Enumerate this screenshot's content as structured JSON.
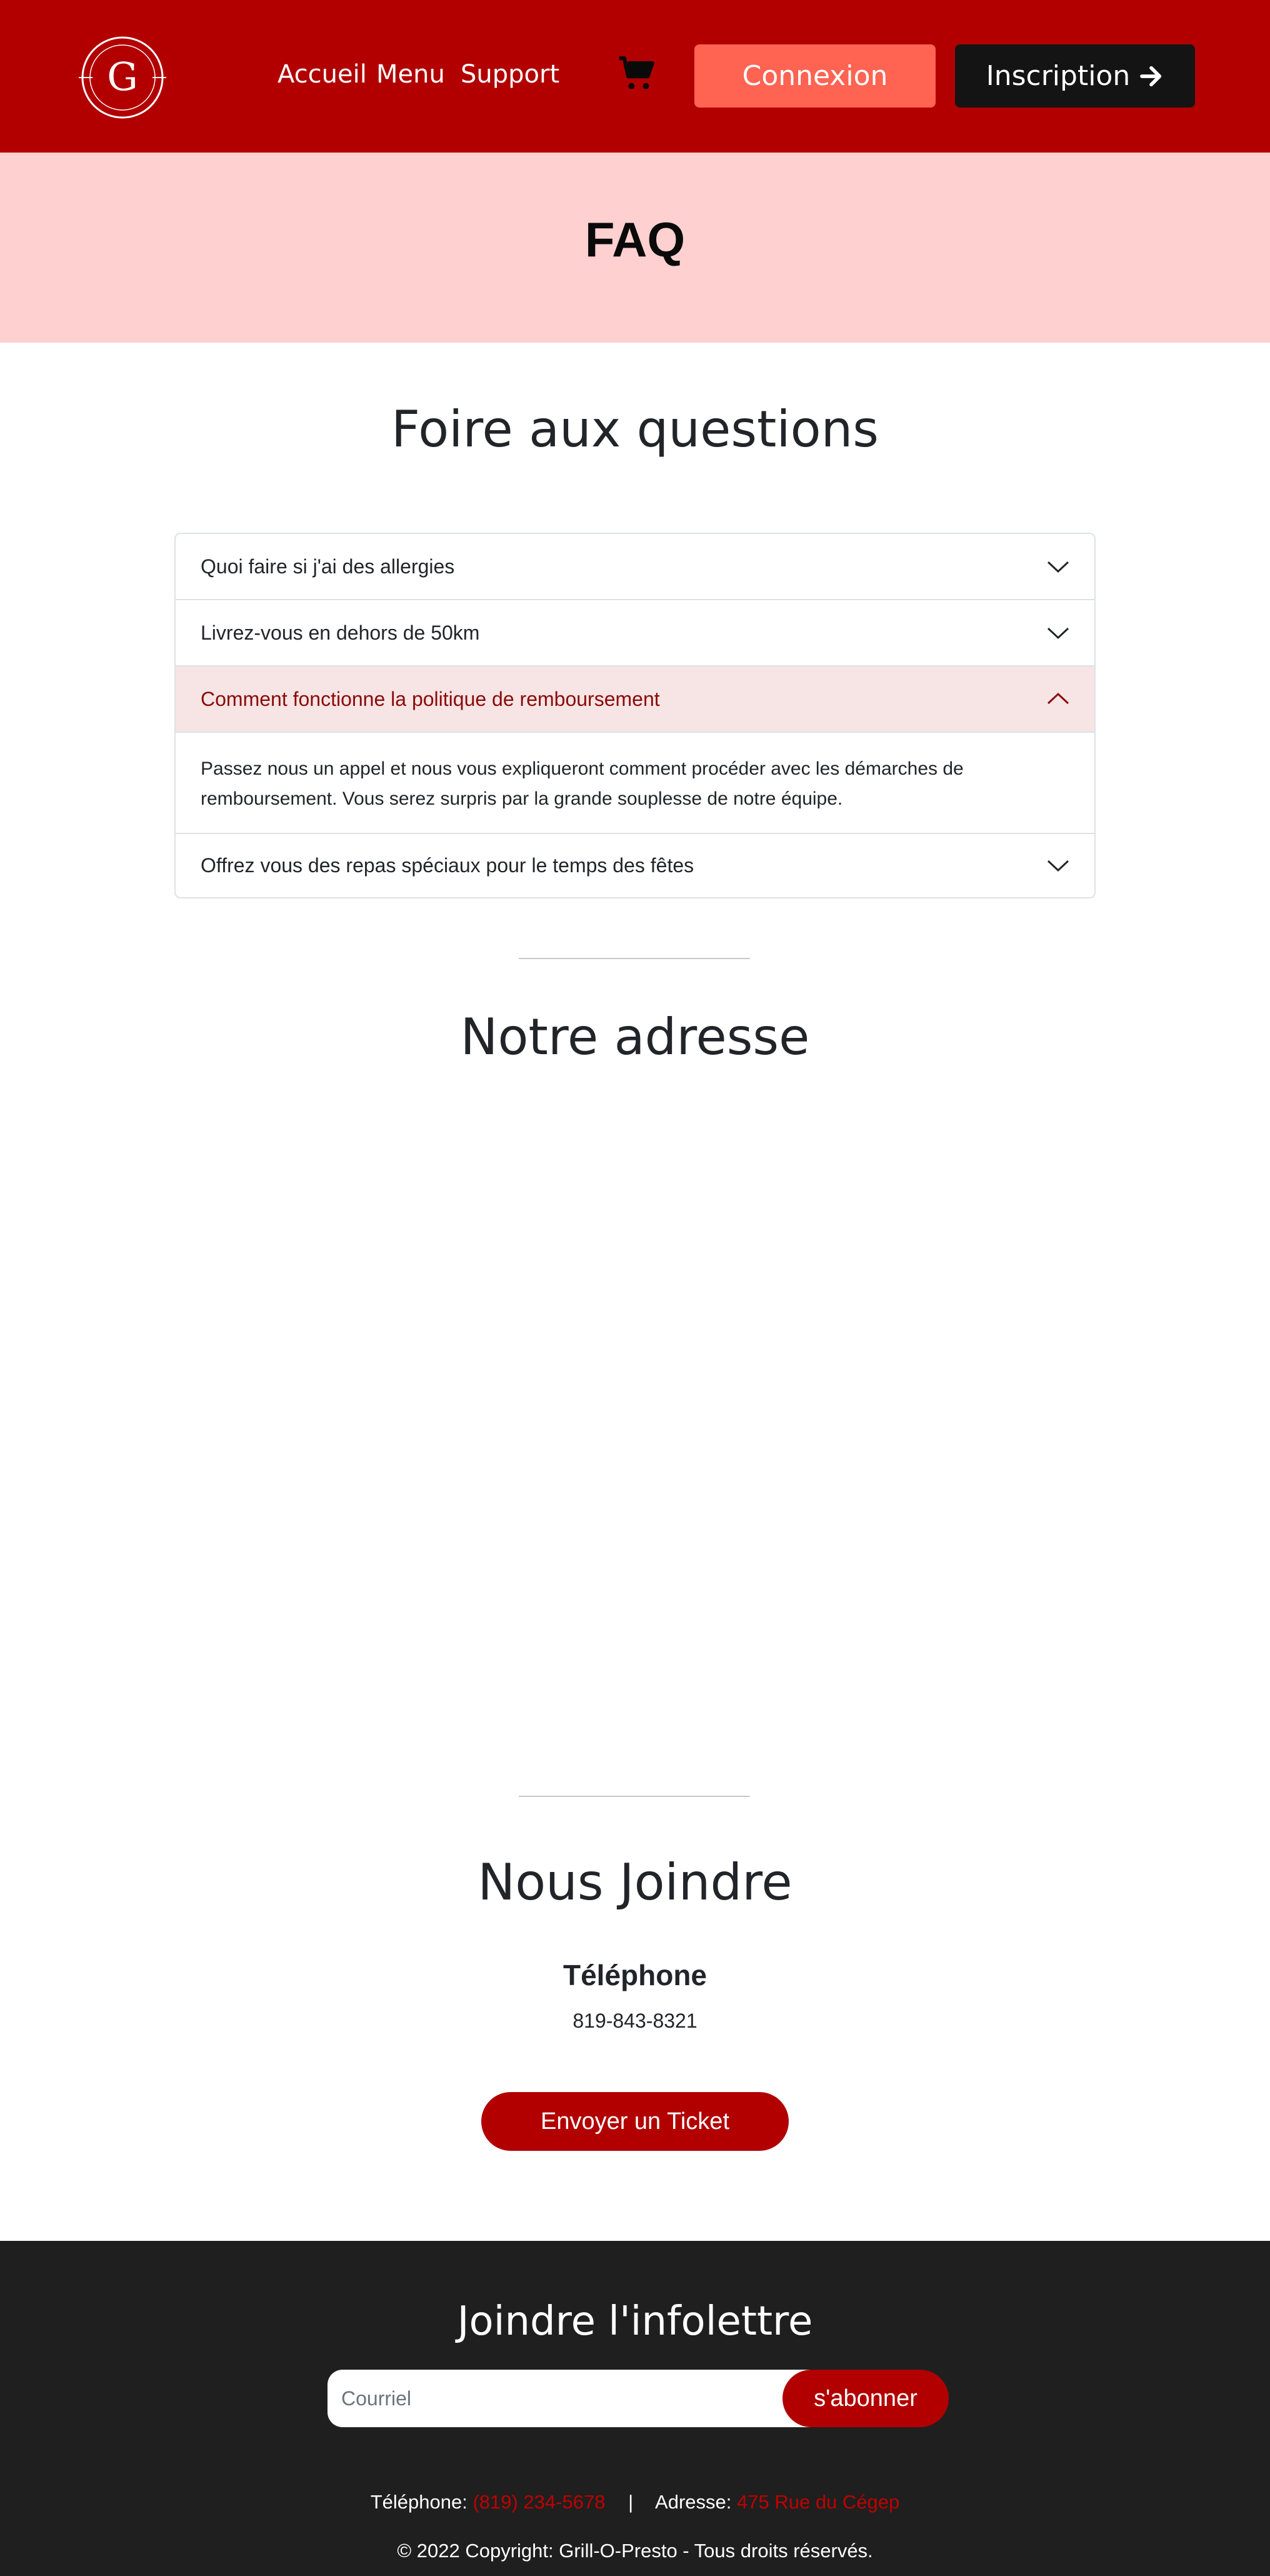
{
  "header": {
    "logo_letter": "G",
    "nav": [
      "Accueil",
      "Menu",
      "Support"
    ],
    "cart_icon": "cart-icon",
    "login_label": "Connexion",
    "signup_label": "Inscription",
    "signup_icon": "arrow-right-icon",
    "colors": {
      "bar": "#b20000",
      "login": "#ff6352",
      "signup": "#141414"
    }
  },
  "banner": {
    "title": "FAQ",
    "background": "#ffd0d0"
  },
  "faq": {
    "title": "Foire aux questions",
    "items": [
      {
        "question": "Quoi faire si j'ai des allergies",
        "expanded": false
      },
      {
        "question": "Livrez-vous en dehors de 50km",
        "expanded": false
      },
      {
        "question": "Comment fonctionne la politique de remboursement",
        "expanded": true,
        "answer": "Passez nous un appel et nous vous expliqueront comment procéder avec les démarches de remboursement. Vous serez surpris par la grande souplesse de notre équipe."
      },
      {
        "question": "Offrez vous des repas spéciaux pour le temps des fêtes",
        "expanded": false
      }
    ]
  },
  "address": {
    "title": "Notre adresse"
  },
  "contact": {
    "title": "Nous Joindre",
    "phone_heading": "Téléphone",
    "phone_value": "819-843-8321",
    "ticket_label": "Envoyer un Ticket"
  },
  "footer": {
    "title": "Joindre l'infolettre",
    "email_placeholder": "Courriel",
    "subscribe_label": "s'abonner",
    "phone_label": "Téléphone:",
    "phone_value": "(819) 234-5678",
    "separator": "|",
    "address_label": "Adresse:",
    "address_value": "475 Rue du Cégep",
    "copyright": "© 2022 Copyright: Grill-O-Presto - Tous droits réservés."
  }
}
